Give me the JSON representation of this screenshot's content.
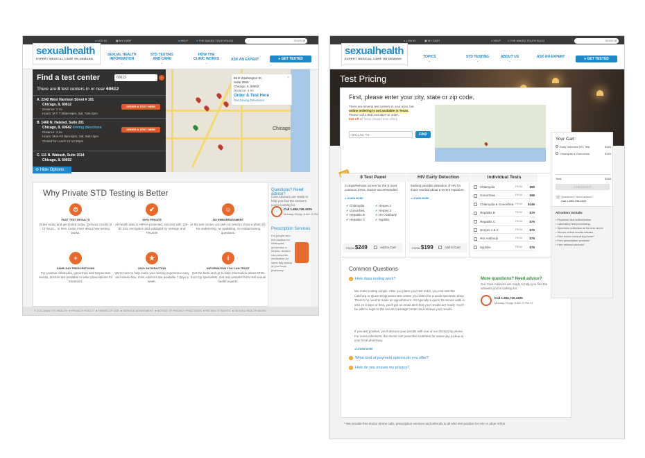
{
  "brand": {
    "name": "sexualhealth",
    "tagline": "EXPERT MEDICAL CARE ON DEMAND"
  },
  "page1": {
    "util": {
      "login": "LOG IN",
      "cart": "MY CART",
      "help": "HELP",
      "blog": "THE NAKED TRUTH BLOG",
      "search_placeholder": "SEARCH"
    },
    "nav": [
      {
        "l1": "SEXUAL HEALTH",
        "l2": "INFORMATION"
      },
      {
        "l1": "STD TESTING",
        "l2": "AND CARE"
      },
      {
        "l1": "HOW THE",
        "l2": "CLINIC WORKS"
      },
      {
        "l1": "ASK AN EXPERT",
        "l2": ""
      }
    ],
    "get_tested": "GET TESTED",
    "finder": {
      "title": "Find a test center",
      "zip": "60612",
      "count_pre": "There are",
      "count": "8",
      "count_mid": "test centers in or near",
      "count_zip": "60612",
      "centers": [
        {
          "line1": "A. 2242 West Harrison Street # 101",
          "line2": "Chicago, IL 60612",
          "dist": "Distance: 2 mi.",
          "hours": "Hours: M-F 7:30am-5pm, Sat. 7am-2pm",
          "btn": "ORDER & TEST HERE"
        },
        {
          "line1": "B. 1460 N. Halsted, Suite 201",
          "line2": "Chicago, IL 60642",
          "dir": "driving directions",
          "dist": "Distance: 3 mi.",
          "hours": "Hours: Mon-Fri 8am-5pm, Sat. 8am-1pm",
          "closed": "Closed for Lunch 12-12:30pm",
          "btn": "ORDER & TEST HERE"
        },
        {
          "line1": "C. 111 N. Wabash, Suite 1514",
          "line2": "Chicago, IL 60602"
        }
      ],
      "hide": "Hide Options"
    },
    "popup": {
      "a1": "55 E Washington St.",
      "a2": "Suite 2500",
      "a3": "Chicago, IL 60602",
      "dist": "Distance: 4 mi.",
      "order": "Order & Test Here",
      "dir": "Get Driving Directions"
    },
    "map_label": "Chicago",
    "why": {
      "title": "Why Private STD Testing is Better",
      "features": [
        {
          "t": "FAST TEST RESULTS",
          "d": "Order today and get tested today. Get your results in 72 hours... or less. Learn more about how testing works.",
          "icon": "stopwatch-icon",
          "g": "⏱"
        },
        {
          "t": "100% PRIVATE",
          "d": "All health data is HIPAA-protected, secured with 128-bit SSL encryption and validated by Verisign and TRUSTe",
          "icon": "privacy-icon",
          "g": "✔"
        },
        {
          "t": "NO EMBARRASSMENT",
          "d": "At the test center, you will not need to show a photo ID. No undressing, no swabbing, no embarrassing questions.",
          "icon": "people-icon",
          "g": "☺"
        },
        {
          "t": "SAME-DAY PRESCRIPTIONS",
          "d": "For positive chlamydia, gonorrhea and herpes test results, doctors are available to write prescriptions for treatment.",
          "icon": "prescription-icon",
          "g": "+"
        },
        {
          "t": "100% SATISFACTION",
          "d": "We're here to help make your testing experience easy and stress-free. Care Advisors are available 7 days a week.",
          "icon": "medal-icon",
          "g": "★"
        },
        {
          "t": "INFORMATION YOU CAN TRUST",
          "d": "Get the facts and up-to-date information about STDs from top specialists. Get real answers from real sexual health experts.",
          "icon": "info-card-icon",
          "g": "i"
        }
      ]
    },
    "side": {
      "q": "Questions? Need advice?",
      "d": "Care Advisors are ready to help you find the answers you're looking for.",
      "call": "Call 1.855.739.4325",
      "hrs": "Monday-Friday, 8 AM -5 PM",
      "rx_title": "Prescription Services",
      "rx": "For people who test positive for chlamydia, gonorrhea or herpes, doctors can prescribe medication for same day pickup at your local pharmacy."
    },
    "footer": [
      "© 2011 ANALYTE HEALTH",
      "PRIVACY POLICY",
      "TERMS OF USE",
      "SERVICE AGREEMENT",
      "NOTICE OF PRIVACY PRACTICES",
      "PATIENT'S RIGHTS",
      "SEXUAL HEALTH NEWS"
    ]
  },
  "page2": {
    "util": {
      "login": "LOG IN",
      "cart": "MY CART",
      "help": "HELP",
      "blog": "THE NAKED TRUTH BLOG",
      "search_placeholder": "SEARCH"
    },
    "nav": [
      "TOPICS",
      "STD TESTING",
      "ABOUT US",
      "ASK AN EXPERT"
    ],
    "get_tested": "GET TESTED",
    "hero_title": "Test Pricing",
    "first": {
      "title": "First, please enter your city, state or zip code.",
      "p1": "There are several test centers in your area, but",
      "p2": "online ordering is not available in Texas.",
      "p3": "Please call 1.855.433.3627 to order.",
      "promo": "$10 off",
      "promo2": "all Tests (limited time offer)",
      "input": "DALLAS, TX",
      "find": "FIND"
    },
    "panel8": {
      "badge": "BEST",
      "title": "8 Test Panel",
      "d": "Comprehensive screen for the 8 most common STDs. Doctor-recommended.",
      "more": "LEARN MORE",
      "left": [
        "Chlamydia",
        "Gonorrhea",
        "Hepatitis B",
        "Hepatitis C"
      ],
      "right": [
        "Herpes 1",
        "Herpes 2",
        "HIV Antibody",
        "Syphilis"
      ],
      "from": "FROM",
      "price": "$249",
      "add": "Add to Cart"
    },
    "hiv": {
      "title": "HIV Early Detection",
      "d": "Earliest possible detection of HIV for those worried about a recent exposure.",
      "more": "LEARN MORE",
      "from": "FROM",
      "price": "$199",
      "add": "Add to Cart"
    },
    "indiv": {
      "title": "Individual Tests",
      "from": "FROM",
      "tests": [
        {
          "n": "Chlamydia",
          "p": "$99"
        },
        {
          "n": "Gonorrhea",
          "p": "$99"
        },
        {
          "n": "Chlamydia & Gonorrhea",
          "p": "$149"
        },
        {
          "n": "Hepatitis B",
          "p": "$79"
        },
        {
          "n": "Hepatitis C",
          "p": "$79"
        },
        {
          "n": "Herpes 1 & 2",
          "p": "$79"
        },
        {
          "n": "HIV Antibody",
          "p": "$79"
        },
        {
          "n": "Syphilis",
          "p": "$79"
        }
      ],
      "add": "Add to Cart"
    },
    "cart": {
      "title": "Your Cart",
      "items": [
        {
          "n": "Early Detection HIV Test",
          "p": "$199"
        },
        {
          "n": "Chlamydia & Gonorrhea",
          "p": "$149"
        }
      ],
      "total_label": "Total",
      "total": "$348",
      "checkout": "CHECKOUT",
      "q": "Questions? Need advice?",
      "call": "Call 1.855.739.4325",
      "incl_title": "All orders include:",
      "incl": [
        "Physician test authorization",
        "Laboratory test processing",
        "Specimen collection at the test center",
        "Secure online results release",
        "Free doctor consult by phone*",
        "Free prescription services*",
        "Free referral services*"
      ]
    },
    "faq": {
      "title": "Common Questions",
      "q1": "How does testing work?",
      "a1": "We make testing simple. After you place your test order, you can visit the LabCorp or Quest Diagnostics test center you select for a quick specimen draw. There's no need to make an appointment. It's typically a quick 15-minute walk in visit. In 3 days or less, you'll get an email alert that your results are ready. You'll be able to login to the secure message center and retrieve your results.",
      "a2": "If you test positive, you'll discuss your results with one of our doctors by phone. For some infections, the doctor can prescribe treatment for same-day pickup at your local pharmacy.",
      "more": "LEARN MORE",
      "q2": "What kind of payment options do you offer?",
      "q3": "How do you ensure my privacy?"
    },
    "side": {
      "q": "More questions? Need advice?",
      "d": "Our Care Advisors are ready to help you find the answers you're looking for.",
      "call": "Call 1.855.739.4325",
      "hrs": "Monday-Friday, 8 AM -5 PM CT"
    },
    "footnote": "* We provide free doctor phone calls, prescription services and referrals to all who test positive for HIV or other STDs"
  }
}
